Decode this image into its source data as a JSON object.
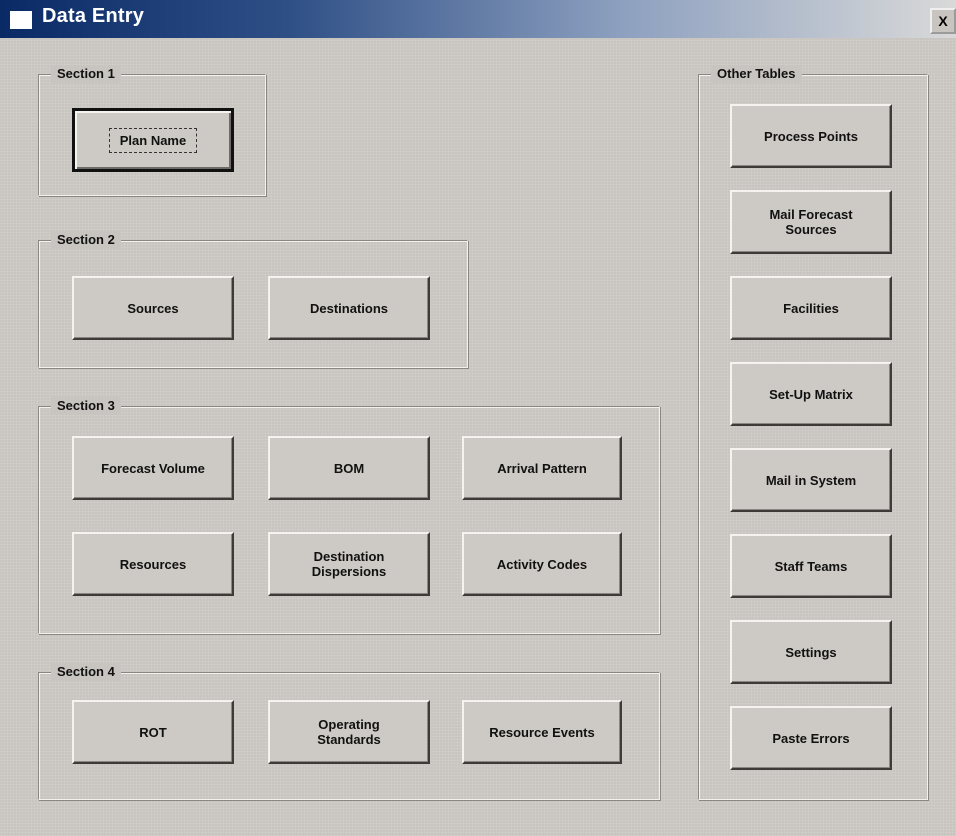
{
  "window": {
    "title": "Data Entry",
    "close_label": "X"
  },
  "sections": {
    "s1": {
      "label": "Section 1",
      "buttons": {
        "plan_name": "Plan Name"
      }
    },
    "s2": {
      "label": "Section 2",
      "buttons": {
        "sources": "Sources",
        "destinations": "Destinations"
      }
    },
    "s3": {
      "label": "Section 3",
      "buttons": {
        "forecast_volume": "Forecast Volume",
        "bom": "BOM",
        "arrival_pattern": "Arrival Pattern",
        "resources": "Resources",
        "destination_dispersions_1": "Destination",
        "destination_dispersions_2": "Dispersions",
        "activity_codes": "Activity Codes"
      }
    },
    "s4": {
      "label": "Section 4",
      "buttons": {
        "rot": "ROT",
        "operating_standards_1": "Operating",
        "operating_standards_2": "Standards",
        "resource_events": "Resource Events"
      }
    }
  },
  "other_tables": {
    "label": "Other Tables",
    "buttons": {
      "process_points": "Process Points",
      "mail_forecast_sources_1": "Mail Forecast",
      "mail_forecast_sources_2": "Sources",
      "facilities": "Facilities",
      "setup_matrix": "Set-Up Matrix",
      "mail_in_system": "Mail in System",
      "staff_teams": "Staff Teams",
      "settings": "Settings",
      "paste_errors": "Paste Errors"
    }
  }
}
